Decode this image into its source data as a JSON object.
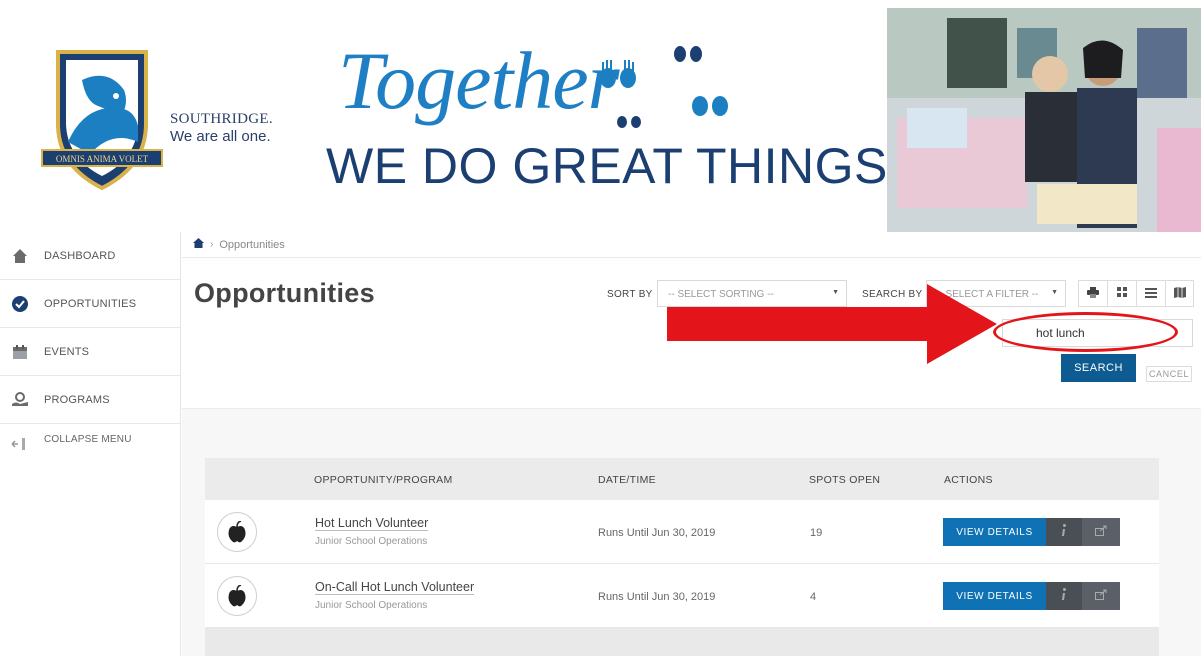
{
  "banner": {
    "crest_motto": "OMNIS ANIMA VOLET",
    "school_name": "SOUTHRIDGE.",
    "school_tagline": "We are all one.",
    "headline_script": "Together",
    "headline_main": "WE DO GREAT THINGS"
  },
  "sidebar": {
    "items": [
      {
        "label": "DASHBOARD",
        "icon": "home-icon"
      },
      {
        "label": "OPPORTUNITIES",
        "icon": "check-circle-icon"
      },
      {
        "label": "EVENTS",
        "icon": "calendar-icon"
      },
      {
        "label": "PROGRAMS",
        "icon": "hand-coin-icon"
      },
      {
        "label": "COLLAPSE MENU",
        "icon": "collapse-arrow-icon"
      }
    ]
  },
  "breadcrumb": {
    "current": "Opportunities"
  },
  "page": {
    "title": "Opportunities"
  },
  "toolbar": {
    "sort_label": "SORT BY",
    "sort_value": "-- SELECT SORTING --",
    "search_by_label": "SEARCH BY",
    "filter_value": "-- SELECT A FILTER --",
    "search_value": "hot lunch",
    "search_button": "SEARCH",
    "cancel_button": "CANCEL"
  },
  "table": {
    "headers": [
      "OPPORTUNITY/PROGRAM",
      "DATE/TIME",
      "SPOTS OPEN",
      "ACTIONS"
    ],
    "rows": [
      {
        "name": "Hot Lunch Volunteer",
        "program": "Junior School Operations",
        "date": "Runs Until Jun 30, 2019",
        "spots": "19",
        "action": "VIEW DETAILS"
      },
      {
        "name": "On-Call Hot Lunch Volunteer",
        "program": "Junior School Operations",
        "date": "Runs Until Jun 30, 2019",
        "spots": "4",
        "action": "VIEW DETAILS"
      }
    ]
  },
  "colors": {
    "primary": "#0e72b5",
    "dark_primary": "#0d5b91",
    "annotation": "#e3151a"
  }
}
